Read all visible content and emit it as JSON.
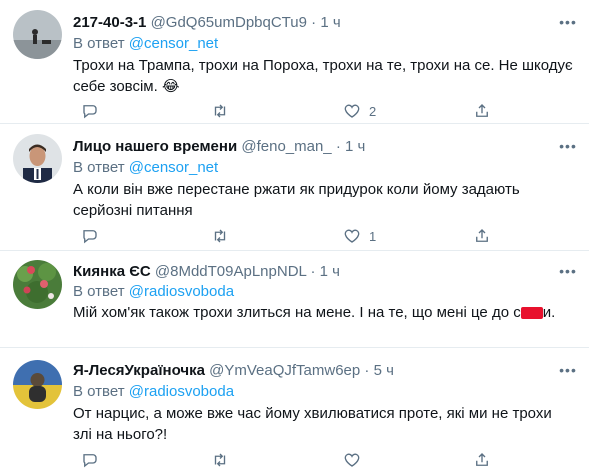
{
  "tweets": [
    {
      "name": "217-40-3-1",
      "handle": "@GdQ65umDpbqCTu9",
      "dot": "·",
      "time": "1 ч",
      "reply_prefix": "В ответ",
      "reply_to": "@censor_net",
      "text": "Трохи на Трампа, трохи на Пороха, трохи на те, трохи на се. Не шкодує себе зовсім. 😂",
      "likes": "2"
    },
    {
      "name": "Лицо нашего времени",
      "handle": "@feno_man_",
      "dot": "·",
      "time": "1 ч",
      "reply_prefix": "В ответ",
      "reply_to": "@censor_net",
      "text": "А коли він вже перестане ржати як придурок коли йому задають серйозні питання",
      "likes": "1"
    },
    {
      "name": "Киянка ЄС",
      "handle": "@8MddT09ApLnpNDL",
      "dot": "·",
      "time": "1 ч",
      "reply_prefix": "В ответ",
      "reply_to": "@radiosvoboda",
      "text_before": "Мій хом'як також трохи злиться на мене. І на те, що мені це до с",
      "text_after": "и.",
      "likes": ""
    },
    {
      "name": "Я-ЛесяУкраїночка",
      "handle": "@YmVeaQJfTamw6ep",
      "dot": "·",
      "time": "5 ч",
      "reply_prefix": "В ответ",
      "reply_to": "@radiosvoboda",
      "text": "От нарцис, а може вже час йому хвилюватися проте, які ми не трохи злі на нього?!",
      "likes": ""
    }
  ],
  "icons": {
    "reply": "reply-icon",
    "retweet": "retweet-icon",
    "like": "heart-icon",
    "share": "share-icon",
    "more": "more-icon"
  },
  "colors": {
    "link": "#1da1f2",
    "secondary": "#5b7083",
    "divider": "#e6ecf0",
    "redaction": "#e8112d"
  }
}
